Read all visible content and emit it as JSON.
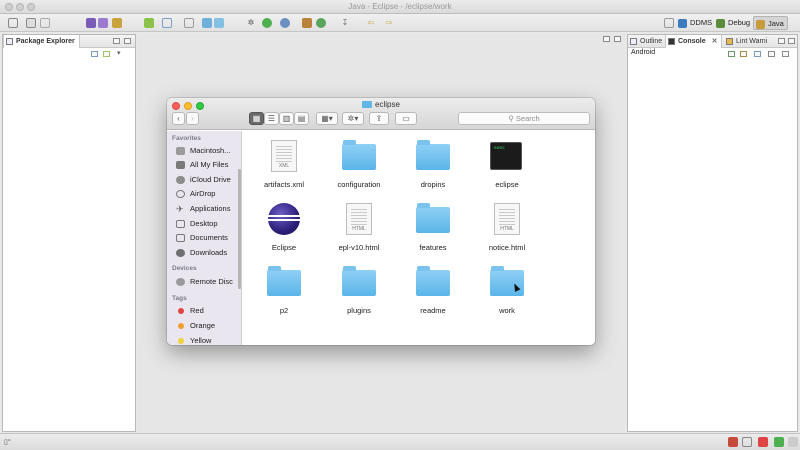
{
  "eclipse": {
    "window_title": "Java - Eclipse - /eclipse/work",
    "perspectives": [
      {
        "label": "DDMS",
        "color": "#3b7bbf",
        "active": false
      },
      {
        "label": "Debug",
        "color": "#5a8c3c",
        "active": false
      },
      {
        "label": "Java",
        "color": "#c89c3c",
        "active": true
      }
    ],
    "package_explorer_tab": "Package Explorer",
    "right_tabs": [
      "Outline",
      "Console",
      "Lint Warni"
    ],
    "right_panel_label": "Android",
    "status_text": "▯°"
  },
  "finder": {
    "title": "eclipse",
    "search_placeholder": "Search",
    "sidebar": {
      "favorites_header": "Favorites",
      "favorites": [
        "Macintosh...",
        "All My Files",
        "iCloud Drive",
        "AirDrop",
        "Applications",
        "Desktop",
        "Documents",
        "Downloads"
      ],
      "devices_header": "Devices",
      "devices": [
        "Remote Disc"
      ],
      "tags_header": "Tags",
      "tags": [
        {
          "label": "Red",
          "color": "#e0443e"
        },
        {
          "label": "Orange",
          "color": "#f29b31"
        },
        {
          "label": "Yellow",
          "color": "#f2d33a"
        }
      ]
    },
    "files": [
      {
        "label": "artifacts.xml",
        "kind": "doc",
        "tag": "XML"
      },
      {
        "label": "configuration",
        "kind": "folder"
      },
      {
        "label": "dropins",
        "kind": "folder"
      },
      {
        "label": "eclipse",
        "kind": "terminal",
        "tag": "exec"
      },
      {
        "label": "Eclipse",
        "kind": "app"
      },
      {
        "label": "epl-v10.html",
        "kind": "doc",
        "tag": "HTML"
      },
      {
        "label": "features",
        "kind": "folder"
      },
      {
        "label": "notice.html",
        "kind": "doc",
        "tag": "HTML"
      },
      {
        "label": "p2",
        "kind": "folder"
      },
      {
        "label": "plugins",
        "kind": "folder"
      },
      {
        "label": "readme",
        "kind": "folder"
      },
      {
        "label": "work",
        "kind": "folder"
      }
    ]
  }
}
